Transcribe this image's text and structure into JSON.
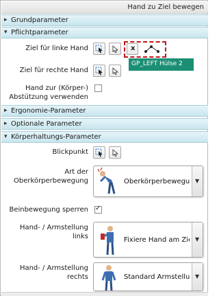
{
  "window": {
    "title": "Hand zu Ziel bewegen"
  },
  "sections": {
    "grundparameter": "Grundparameter",
    "pflichtparameter": "Pflichtparameter",
    "ergonomie": "Ergonomie-Parameter",
    "optionale": "Optionale Parameter",
    "koerperhaltung": "Körperhaltungs-Parameter"
  },
  "pflicht": {
    "ziel_links_label": "Ziel für linke Hand",
    "ziel_rechts_label": "Ziel für rechte Hand",
    "hand_abstuetzung_label_1": "Hand zur (Körper-)",
    "hand_abstuetzung_label_2": "Abstützung verwenden",
    "clear_button": "x",
    "tooltip": "GP_LEFT Hülse 2"
  },
  "koerper": {
    "blickpunkt_label": "Blickpunkt",
    "oberkoerper_label_1": "Art der",
    "oberkoerper_label_2": "Oberkörperbewegung",
    "oberkoerper_value": "Oberkörperbewegung (",
    "beinbewegung_label": "Beinbewegung sperren",
    "beinbewegung_checked": true,
    "hand_links_label": "Hand- / Armstellung links",
    "hand_links_value": "Fixiere Hand am Ziel",
    "hand_rechts_label": "Hand- / Armstellung rechts",
    "hand_rechts_value": "Standard Armstellung"
  },
  "colors": {
    "section_bg": "#c8e6ee",
    "tooltip_bg": "#1b8f74",
    "highlight_border": "#c0161c"
  }
}
